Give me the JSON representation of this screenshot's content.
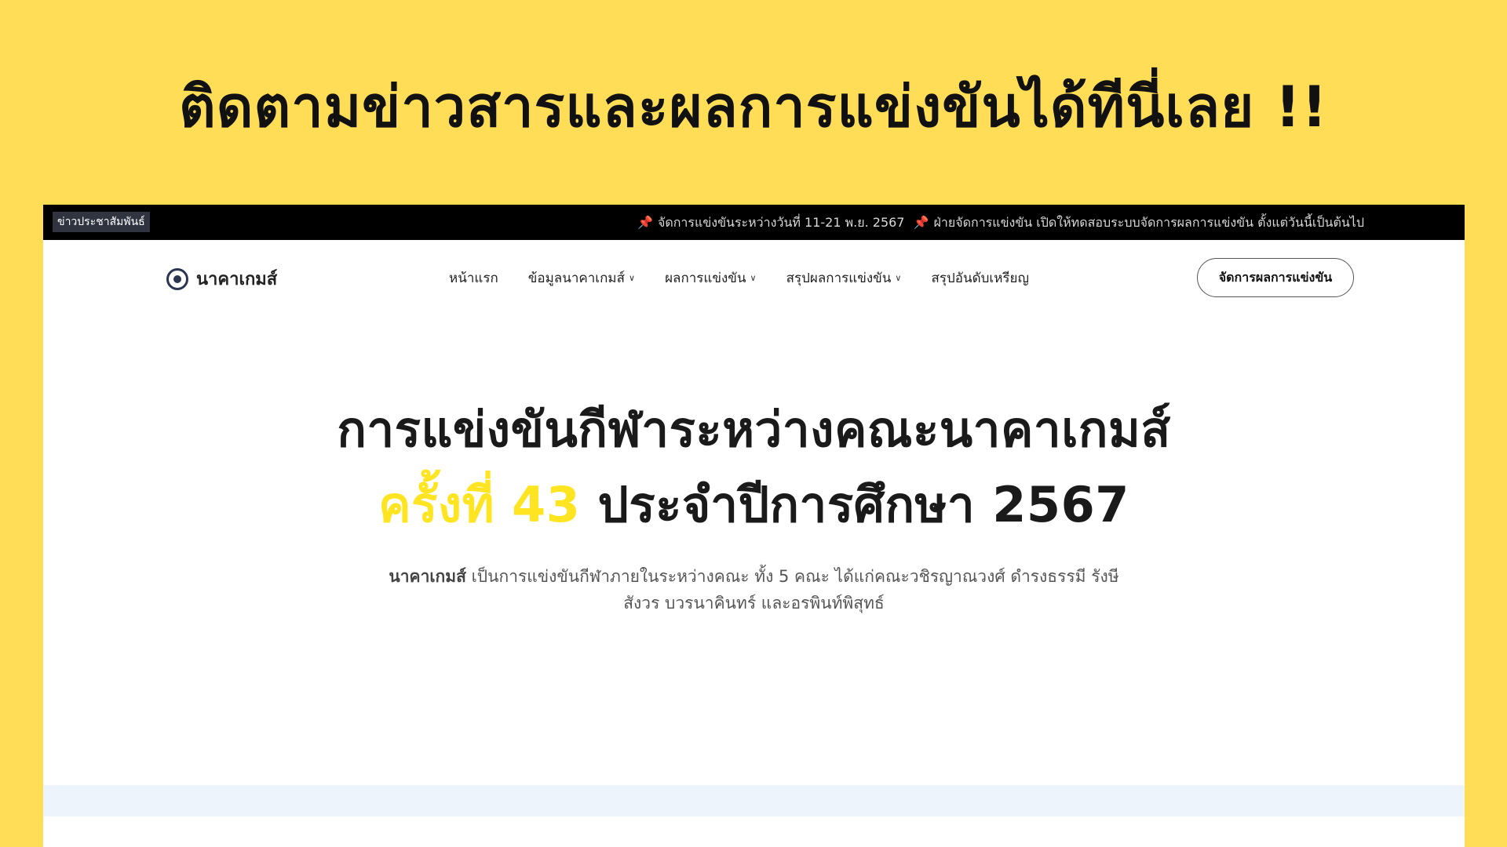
{
  "promo": {
    "title": "ติดตามข่าวสารและผลการแข่งขันได้ทีนี่เลย !!"
  },
  "topbar": {
    "badge": "ข่าวประชาสัมพันธ์",
    "ticker_1": "จัดการแข่งขันระหว่างวันที่ 11-21 พ.ย. 2567",
    "ticker_2": "ฝ่ายจัดการแข่งขัน เปิดให้ทดสอบระบบจัดการผลการแข่งขัน ตั้งแต่วันนี้เป็นต้นไป"
  },
  "navbar": {
    "logo_text": "นาคาเกมส์",
    "items": [
      {
        "label": "หน้าแรก",
        "dropdown": false
      },
      {
        "label": "ข้อมูลนาคาเกมส์",
        "dropdown": true
      },
      {
        "label": "ผลการแข่งขัน",
        "dropdown": true
      },
      {
        "label": "สรุปผลการแข่งขัน",
        "dropdown": true
      },
      {
        "label": "สรุปอันดับเหรียญ",
        "dropdown": false
      }
    ],
    "cta_label": "จัดการผลการแข่งขัน"
  },
  "hero": {
    "line1": "การแข่งขันกีฬาระหว่างคณะนาคาเกมส์",
    "line2_highlight": "ครั้งที่ 43",
    "line2_rest": " ประจำปีการศึกษา 2567",
    "desc_bold": "นาคาเกมส์",
    "desc_rest": " เป็นการแข่งขันกีฬาภายในระหว่างคณะ ทั้ง 5 คณะ ได้แก่คณะวชิรญาณวงศ์ ดำรงธรรมี รังษี สังวร บวรนาคินทร์ และอรพินท์พิสุทธ์"
  },
  "colors": {
    "background": "#FFDD57",
    "highlight": "#FFE521",
    "topbar": "#000000",
    "strip": "#EEF4FC"
  },
  "icons": {
    "pin": "pushpin-icon",
    "chevron": "chevron-down-icon",
    "logo": "nakha-logo-icon"
  }
}
